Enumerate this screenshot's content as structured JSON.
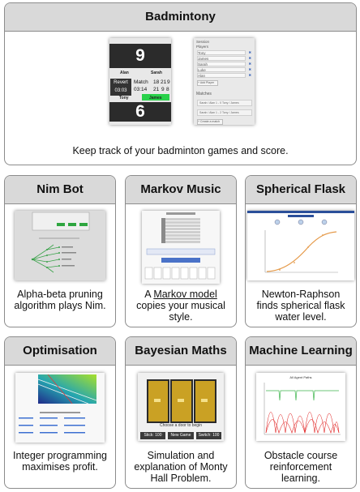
{
  "cards": [
    {
      "id": "badmintony",
      "title": "Badmintony",
      "description": "Keep track of your badminton games and score.",
      "scoreboard": {
        "top_score": "9",
        "bottom_score": "6",
        "players_top": [
          "Alan",
          "Sarah"
        ],
        "players_bottom": [
          "Tony",
          "James"
        ],
        "revert_label": "Revert",
        "revert_time": "03:03",
        "match_label": "Match",
        "match_time": "03:14",
        "set_scores_1": "18",
        "set_scores_2": "21",
        "set_scores_3": "9",
        "set_scores_4": "21",
        "set_scores_5": "9",
        "set_scores_6": "8"
      },
      "session": {
        "title": "Session",
        "players_label": "Players",
        "players": [
          "Tony",
          "James",
          "Sarah",
          "Luke",
          "Alan"
        ],
        "add_player": "+ Add Player",
        "matches_label": "Matches",
        "matches": [
          "Sarah / Alan 1 - 0 Tony / James",
          "Sarah / Alan 1 - 2 Tony / James"
        ],
        "create_match": "+ Create a match"
      }
    },
    {
      "id": "nim-bot",
      "title": "Nim Bot",
      "description": "Alpha-beta pruning algorithm plays Nim."
    },
    {
      "id": "markov-music",
      "title": "Markov Music",
      "description_prefix": "A ",
      "description_link": "Markov model",
      "description_suffix": " copies your musical style."
    },
    {
      "id": "spherical-flask",
      "title": "Spherical Flask",
      "description": "Newton-Raphson finds spherical flask water level."
    },
    {
      "id": "optimisation",
      "title": "Optimisation",
      "description": "Integer programming maximises profit."
    },
    {
      "id": "bayesian-maths",
      "title": "Bayesian Maths",
      "description": "Simulation and explanation of Monty Hall Problem.",
      "thumb": {
        "prompt": "Choose a door to begin",
        "buttons": [
          "Stick: 100",
          "New Game",
          "Switch: 100"
        ]
      }
    },
    {
      "id": "machine-learning",
      "title": "Machine Learning",
      "description": "Obstacle course reinforcement learning.",
      "thumb": {
        "chart_title": "All Agent Paths"
      }
    }
  ],
  "colors": {
    "header_bg": "#d9d9d9",
    "border": "#8c8c8c",
    "scoreboard_dark": "#2b2b2b",
    "green_button": "#29d14a",
    "door": "#caa124"
  }
}
